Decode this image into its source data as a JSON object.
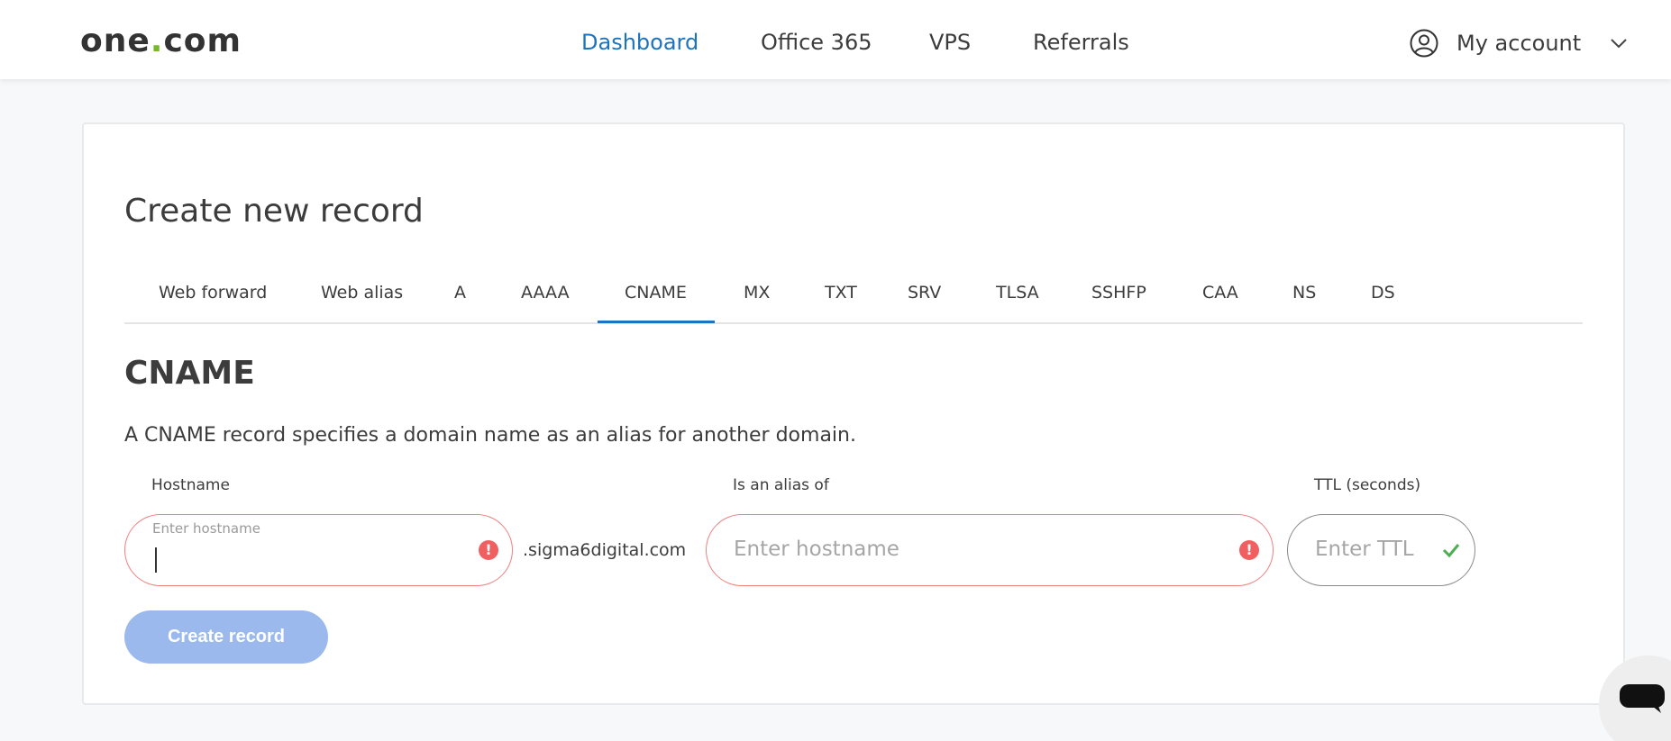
{
  "header": {
    "logo_part1": "one",
    "logo_dot": ".",
    "logo_part2": "com",
    "nav": [
      "Dashboard",
      "Office 365",
      "VPS",
      "Referrals"
    ],
    "account_label": "My account",
    "accent_color": "#1e73be",
    "logo_dot_color": "#76b82a"
  },
  "page": {
    "title": "Create new record",
    "tabs": [
      "Web forward",
      "Web alias",
      "A",
      "AAAA",
      "CNAME",
      "MX",
      "TXT",
      "SRV",
      "TLSA",
      "SSHFP",
      "CAA",
      "NS",
      "DS"
    ],
    "active_tab": "CNAME",
    "section_title": "CNAME",
    "description": "A CNAME record specifies a domain name as an alias for another domain."
  },
  "form": {
    "hostname": {
      "label": "Hostname",
      "floating_label": "Enter hostname",
      "value": "",
      "suffix": ".sigma6digital.com",
      "state": "error"
    },
    "alias": {
      "label": "Is an alias of",
      "placeholder": "Enter hostname",
      "value": "",
      "state": "error"
    },
    "ttl": {
      "label": "TTL (seconds)",
      "placeholder": "Enter TTL",
      "value": "",
      "state": "valid"
    },
    "submit_label": "Create record"
  },
  "icons": {
    "error": "exclamation-icon",
    "valid": "check-icon",
    "account": "user-circle-icon",
    "chat": "chat-bubble-icon"
  }
}
